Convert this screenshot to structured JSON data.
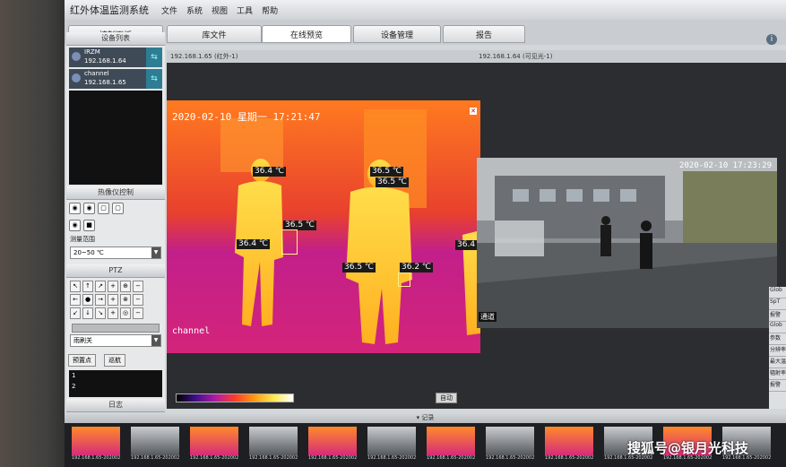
{
  "window": {
    "title": "红外体温监测系统"
  },
  "menu": [
    "文件",
    "系统",
    "视图",
    "工具",
    "帮助"
  ],
  "tabs": [
    {
      "label": "控制面板"
    },
    {
      "label": "库文件"
    },
    {
      "label": "在线预览",
      "active": true
    },
    {
      "label": "设备管理"
    },
    {
      "label": "报告"
    }
  ],
  "device_list": {
    "title": "设备列表",
    "devices": [
      {
        "name": "IRZM",
        "ip": "192.168.1.64"
      },
      {
        "name": "channel",
        "ip": "192.168.1.65"
      }
    ]
  },
  "thermal_panel": {
    "title": "热像仪控制",
    "range_label": "测量范围",
    "range_value": "20~50 ℃"
  },
  "ptz": {
    "title": "PTZ",
    "preset_select": "雨刷关",
    "btn_preset": "预置点",
    "btn_patrol": "巡航",
    "rows": [
      "1",
      "2"
    ]
  },
  "views": {
    "left_header": "192.168.1.65 (红外-1)",
    "right_header": "192.168.1.64 (可见光-1)",
    "thermal_datetime": "2020-02-10  星期一  17:21:47",
    "thermal_channel": "channel",
    "visible_datetime": "2020-02-10  17:23:29",
    "visible_tag": "通道",
    "auto_button": "自动",
    "temperatures": [
      "36.4 ℃",
      "36.5 ℃",
      "36.5 ℃",
      "36.5 ℃",
      "36.4 ℃",
      "36.5 ℃",
      "36.2 ℃",
      "36.4"
    ]
  },
  "bottom": {
    "log_label": "日志",
    "record_label": "▾ 记录",
    "thumb_caption": "192.168.1.65-202002..."
  },
  "right_strip": [
    "Glob",
    "SpT",
    "报警",
    "Glob",
    "参数",
    "分辨率",
    "最大温",
    "辐射率",
    "报警"
  ],
  "watermark": "搜狐号@银月光科技",
  "colors": {
    "thermal_hot": "#ffe850",
    "thermal_mid": "#ff3b2a",
    "thermal_cool": "#b01aa8",
    "device_arrow": "#2f7d92"
  }
}
